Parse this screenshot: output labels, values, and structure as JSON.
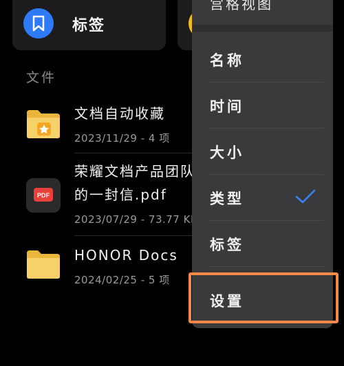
{
  "cards": {
    "tag_label": "标签"
  },
  "section": {
    "title": "文件"
  },
  "files": [
    {
      "name_line1": "文档自动收藏",
      "name_line2": "",
      "meta": "2023/11/29 - 4 项",
      "type": "star-folder"
    },
    {
      "name_line1": "荣耀文档产品团队",
      "name_line2": "的一封信.pdf",
      "meta": "2023/07/29 - 73.77 KB",
      "type": "pdf",
      "badge": "PDF"
    },
    {
      "name_line1": "HONOR Docs",
      "name_line2": "",
      "meta": "2024/02/25 - 5 项",
      "type": "folder"
    }
  ],
  "menu": {
    "top_item": "宫格视图",
    "items": [
      {
        "label": "名称",
        "checked": false
      },
      {
        "label": "时间",
        "checked": false
      },
      {
        "label": "大小",
        "checked": false
      },
      {
        "label": "类型",
        "checked": true
      },
      {
        "label": "标签",
        "checked": false
      },
      {
        "label": "设置",
        "checked": false
      }
    ]
  },
  "colors": {
    "accent": "#2f7bf5",
    "folder": "#f3c54a",
    "highlight": "#f2894a",
    "check": "#3b82f6"
  }
}
